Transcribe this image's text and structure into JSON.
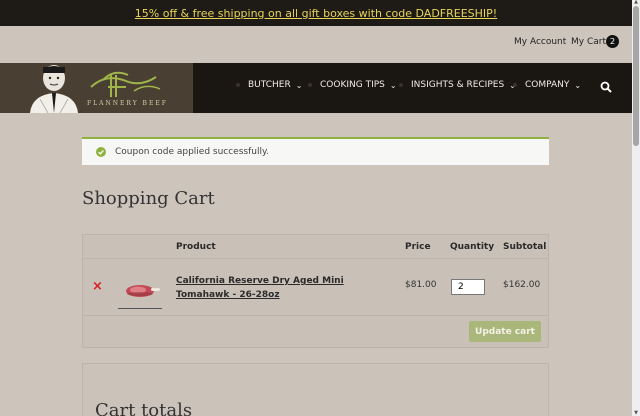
{
  "promo": {
    "text": "15% off & free shipping on all gift boxes with code DADFREESHIP!"
  },
  "account": {
    "my_account": "My Account",
    "my_cart": "My Cart",
    "cart_count": "2"
  },
  "logo": {
    "brand": "FLANNERY BEEF"
  },
  "nav": {
    "items": [
      {
        "label": "BUTCHER"
      },
      {
        "label": "COOKING TIPS"
      },
      {
        "label": "INSIGHTS & RECIPES"
      },
      {
        "label": "COMPANY"
      }
    ],
    "search_icon": "search-icon"
  },
  "notice": {
    "message": "Coupon code applied successfully."
  },
  "cart": {
    "title": "Shopping Cart",
    "columns": {
      "product": "Product",
      "price": "Price",
      "quantity": "Quantity",
      "subtotal": "Subtotal"
    },
    "items": [
      {
        "name": "California Reserve Dry Aged Mini Tomahawk - 26-28oz",
        "price": "$81.00",
        "quantity": "2",
        "subtotal": "$162.00"
      }
    ],
    "update_button": "Update cart"
  },
  "totals": {
    "title": "Cart totals"
  },
  "colors": {
    "accent": "#8fb23e",
    "remove": "#d42020",
    "promo_text": "#e8d55a"
  }
}
